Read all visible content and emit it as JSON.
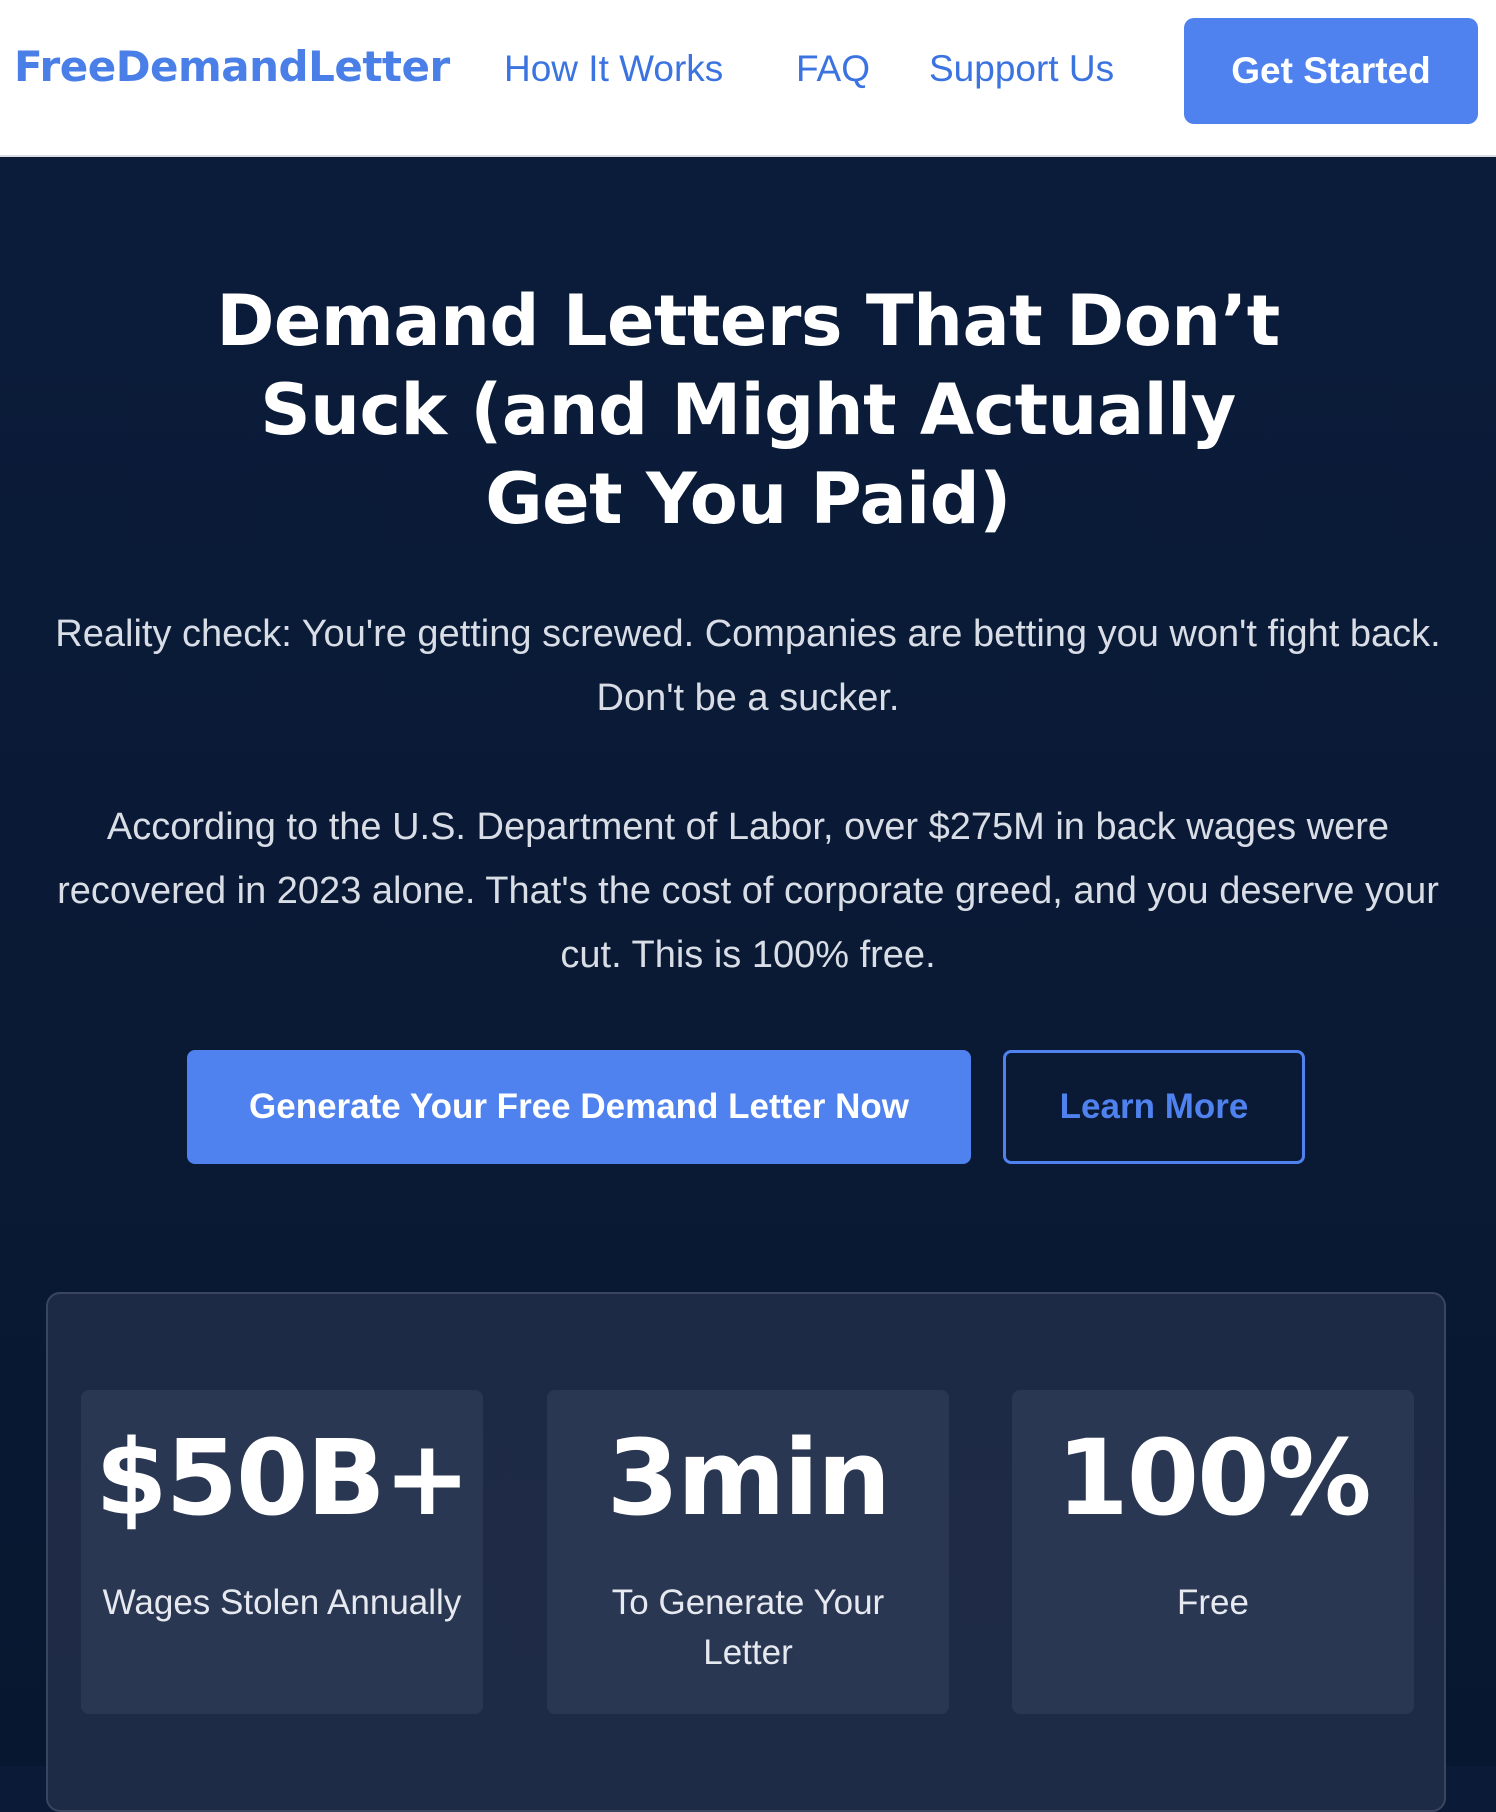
{
  "header": {
    "logo": "FreeDemandLetter",
    "nav": {
      "how_it_works": "How It Works",
      "faq": "FAQ",
      "support_us": "Support Us"
    },
    "cta": "Get Started"
  },
  "hero": {
    "title": "Demand Letters That Don’t Suck (and Might Actually Get You Paid)",
    "paragraph1": "Reality check: You're getting screwed. Companies are betting you won't fight back. Don't be a sucker.",
    "paragraph2": "According to the U.S. Department of Labor, over $275M in back wages were recovered in 2023 alone. That's the cost of corporate greed, and you deserve your cut. This is 100% free.",
    "primary_button": "Generate Your Free Demand Letter Now",
    "secondary_button": "Learn More"
  },
  "stats": [
    {
      "value": "$50B+",
      "label": "Wages Stolen Annually"
    },
    {
      "value": "3min",
      "label": "To Generate Your Letter"
    },
    {
      "value": "100%",
      "label": "Free"
    }
  ],
  "colors": {
    "accent": "#4f82ee",
    "logo": "#4a7fe8",
    "hero_bg": "#0b1c3b",
    "panel_bg": "#1d2a45",
    "card_bg": "#2a3752"
  }
}
